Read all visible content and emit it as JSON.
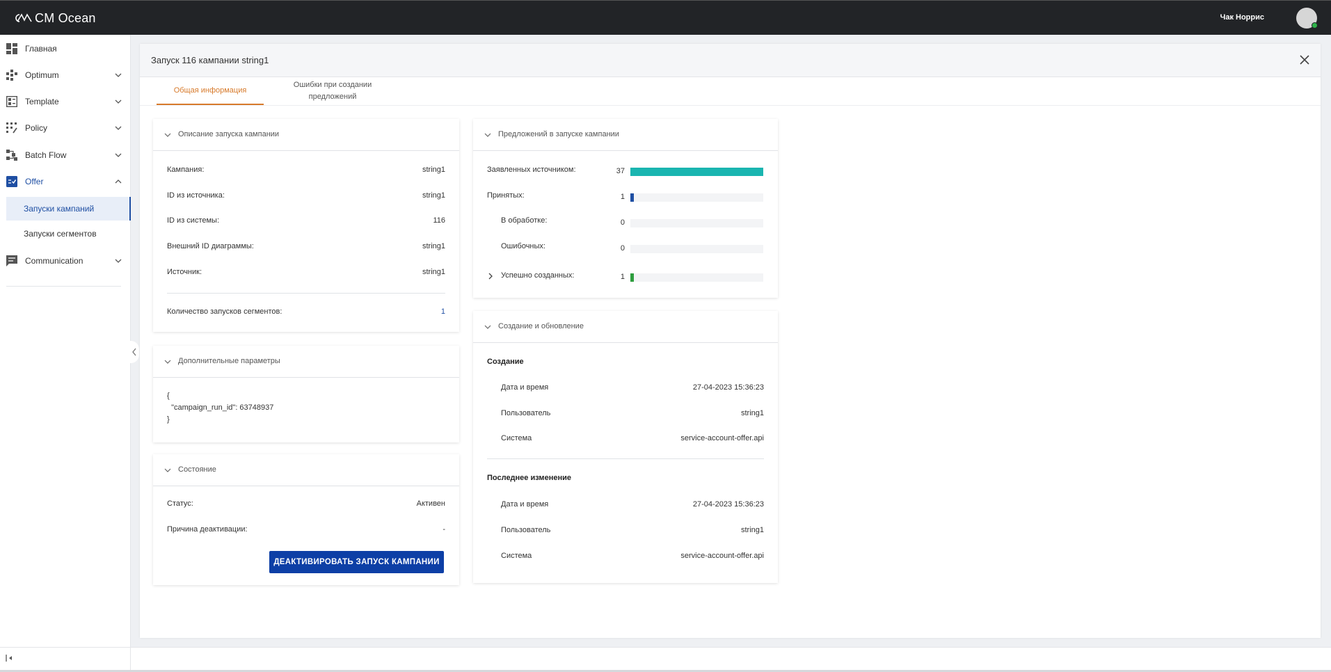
{
  "app": {
    "logo_text": "CM Ocean",
    "user_name": "Чак Норрис"
  },
  "sidebar": {
    "items": [
      {
        "label": "Главная",
        "icon": "dashboard-icon"
      },
      {
        "label": "Optimum",
        "icon": "optimum-icon"
      },
      {
        "label": "Template",
        "icon": "template-icon"
      },
      {
        "label": "Policy",
        "icon": "policy-icon"
      },
      {
        "label": "Batch Flow",
        "icon": "batch-flow-icon"
      },
      {
        "label": "Offer",
        "icon": "offer-icon"
      },
      {
        "label": "Communication",
        "icon": "communication-icon"
      }
    ],
    "offer_sub": [
      {
        "label": "Запуски кампаний"
      },
      {
        "label": "Запуски сегментов"
      }
    ]
  },
  "panel": {
    "title": "Запуск 116 кампании string1",
    "tabs": [
      {
        "label": "Общая информация"
      },
      {
        "label": "Ошибки при создании предложений"
      }
    ]
  },
  "description": {
    "title": "Описание запуска кампании",
    "rows": [
      {
        "label": "Кампания:",
        "value": "string1"
      },
      {
        "label": "ID из источника:",
        "value": "string1"
      },
      {
        "label": "ID из системы:",
        "value": "116"
      },
      {
        "label": "Внешний ID диаграммы:",
        "value": "string1"
      },
      {
        "label": "Источник:",
        "value": "string1"
      }
    ],
    "segments_label": "Количество запусков сегментов:",
    "segments_value": "1"
  },
  "extra_params": {
    "title": "Дополнительные параметры",
    "json": "{\n  \"campaign_run_id\": 63748937\n}"
  },
  "state": {
    "title": "Состояние",
    "status_label": "Статус:",
    "status_value": "Активен",
    "reason_label": "Причина деактивации:",
    "reason_value": "-",
    "deactivate_button": "ДЕАКТИВИРОВАТЬ ЗАПУСК КАМПАНИИ"
  },
  "offers": {
    "title": "Предложений в запуске кампании",
    "max": 37,
    "rows": [
      {
        "label": "Заявленных источником:",
        "value": 37,
        "display": "37",
        "color": "#1ab5b0"
      },
      {
        "label": "Принятых:",
        "value": 1,
        "display": "1",
        "color": "#1f4fa3"
      },
      {
        "label": "В обработке:",
        "value": 0,
        "display": "0",
        "color": "#888888"
      },
      {
        "label": "Ошибочных:",
        "value": 0,
        "display": "0",
        "color": "#d9534f"
      },
      {
        "label": "Успешно созданных:",
        "value": 1,
        "display": "1",
        "color": "#2e9e3e"
      }
    ]
  },
  "audit": {
    "title": "Создание и обновление",
    "created": {
      "heading": "Создание",
      "rows": [
        {
          "label": "Дата и время",
          "value": "27-04-2023 15:36:23"
        },
        {
          "label": "Пользователь",
          "value": "string1"
        },
        {
          "label": "Система",
          "value": "service-account-offer.api"
        }
      ]
    },
    "modified": {
      "heading": "Последнее изменение",
      "rows": [
        {
          "label": "Дата и время",
          "value": "27-04-2023 15:36:23"
        },
        {
          "label": "Пользователь",
          "value": "string1"
        },
        {
          "label": "Система",
          "value": "service-account-offer.api"
        }
      ]
    }
  }
}
